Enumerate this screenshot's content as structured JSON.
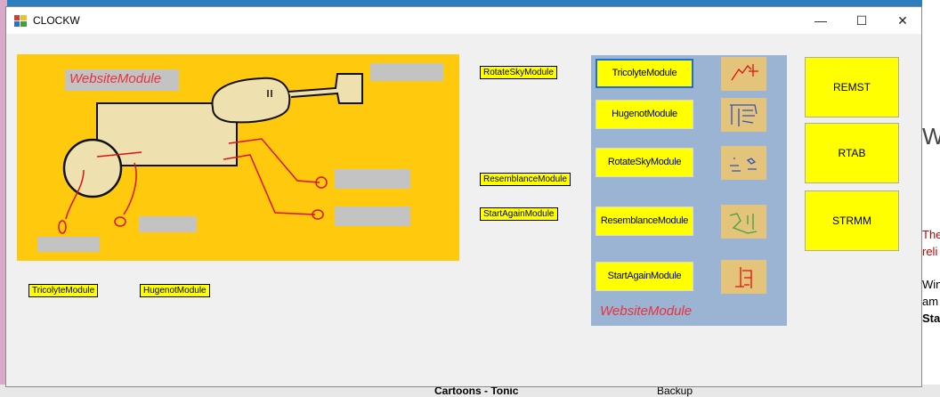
{
  "window": {
    "title": "CLOCKW"
  },
  "caption_buttons": {
    "minimize": "—",
    "maximize": "☐",
    "close": "✕"
  },
  "canvas": {
    "website_module_label": "WebsiteModule"
  },
  "labels": {
    "rotate_sky": "RotateSkyModule",
    "resemblance": "ResemblanceModule",
    "start_again": "StartAgainModule",
    "tricolyte": "TricolyteModule",
    "hugenot": "HugenotModule"
  },
  "module_panel": {
    "buttons": [
      {
        "label": "TricolyteModule",
        "icon": "tricolyte-glyph-icon"
      },
      {
        "label": "HugenotModule",
        "icon": "hugenot-glyph-icon"
      },
      {
        "label": "RotateSkyModule",
        "icon": "rotatesky-glyph-icon"
      },
      {
        "label": "ResemblanceModule",
        "icon": "resemblance-glyph-icon"
      },
      {
        "label": "StartAgainModule",
        "icon": "startagain-glyph-icon"
      }
    ],
    "footer_label": "WebsiteModule"
  },
  "side_buttons": {
    "remst": "REMST",
    "rtab": "RTAB",
    "strmm": "STRMM"
  },
  "background": {
    "right_snippets": [
      "W",
      "The",
      "reli",
      "Win",
      "am",
      "Sta"
    ],
    "bottom_snippets": [
      "Cartoons - Tonic",
      "Backup"
    ]
  },
  "colors": {
    "panel_yellow": "#ffc90e",
    "button_yellow": "#ffff00",
    "panel_blue": "#9bb4d4",
    "accent_red": "#e8323c"
  }
}
